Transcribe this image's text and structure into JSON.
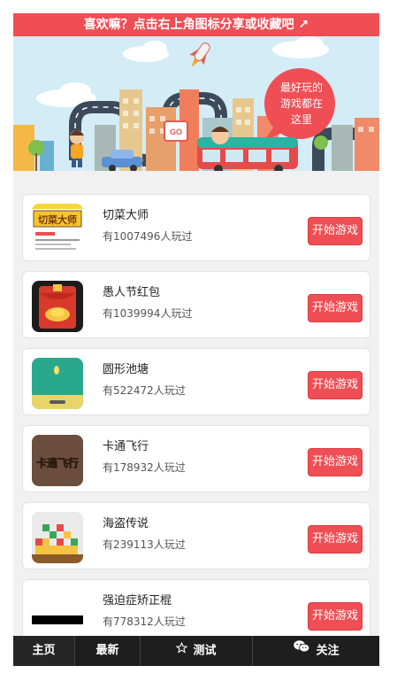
{
  "share_bar": {
    "text": "喜欢嘛？点击右上角图标分享或收藏吧 ↗"
  },
  "banner": {
    "bubble_text": [
      "最好玩的",
      "游戏都在",
      "这里"
    ],
    "go_sign": "GO"
  },
  "games": [
    {
      "title": "切菜大师",
      "meta": "有1007496人玩过",
      "button": "开始游戏",
      "icon": "vegetable-cutting-game-icon"
    },
    {
      "title": "愚人节红包",
      "meta": "有1039994人玩过",
      "button": "开始游戏",
      "icon": "red-envelope-game-icon"
    },
    {
      "title": "圆形池塘",
      "meta": "有522472人玩过",
      "button": "开始游戏",
      "icon": "round-pond-game-icon"
    },
    {
      "title": "卡通飞行",
      "meta": "有178932人玩过",
      "button": "开始游戏",
      "icon": "cartoon-flight-game-icon"
    },
    {
      "title": "海盗传说",
      "meta": "有239113人玩过",
      "button": "开始游戏",
      "icon": "pirate-legend-game-icon"
    },
    {
      "title": "强迫症矫正棍",
      "meta": "有778312人玩过",
      "button": "开始游戏",
      "icon": "ocd-stick-game-icon"
    }
  ],
  "thumb_texts": {
    "game1": "切菜大师",
    "game4": "卡通飞行"
  },
  "tabbar": [
    {
      "label": "主页",
      "icon": ""
    },
    {
      "label": "最新",
      "icon": ""
    },
    {
      "label": "测试",
      "icon": "star-icon"
    },
    {
      "label": "关注",
      "icon": "wechat-icon"
    }
  ],
  "colors": {
    "accent": "#ef4e54",
    "tabbar": "#1e1e1e"
  }
}
